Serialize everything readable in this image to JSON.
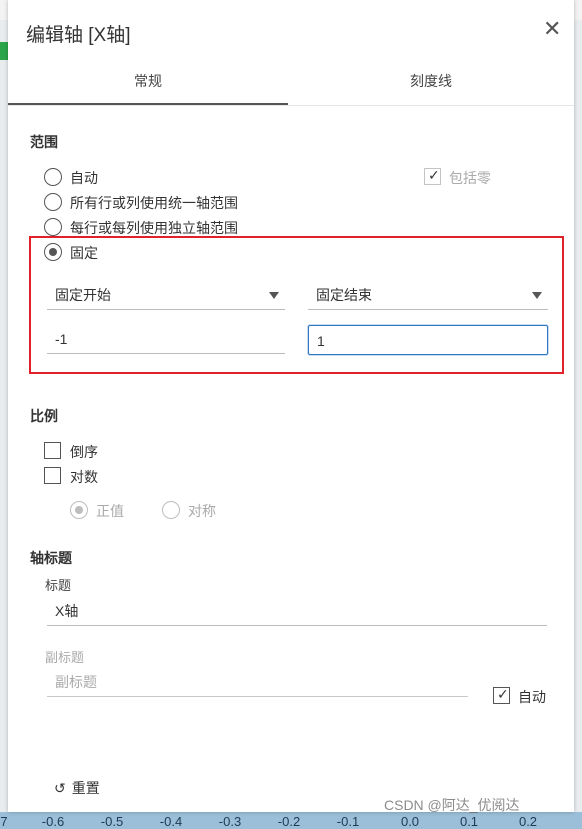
{
  "dialog": {
    "title": "编辑轴 [X轴]",
    "close_icon": "close-icon"
  },
  "tabs": [
    {
      "label": "常规",
      "active": true
    },
    {
      "label": "刻度线",
      "active": false
    }
  ],
  "range": {
    "section_title": "范围",
    "options": [
      {
        "label": "自动",
        "checked": false
      },
      {
        "label": "所有行或列使用统一轴范围",
        "checked": false
      },
      {
        "label": "每行或每列使用独立轴范围",
        "checked": false
      },
      {
        "label": "固定",
        "checked": true
      }
    ],
    "include_zero": {
      "label": "包括零",
      "checked": true,
      "disabled": true
    },
    "fixed_start": {
      "label": "固定开始",
      "value": "-1"
    },
    "fixed_end": {
      "label": "固定结束",
      "value": "1"
    }
  },
  "scale": {
    "section_title": "比例",
    "reversed": {
      "label": "倒序",
      "checked": false
    },
    "log": {
      "label": "对数",
      "checked": false
    },
    "positive": {
      "label": "正值",
      "checked": true,
      "disabled": true
    },
    "symmetric": {
      "label": "对称",
      "checked": false,
      "disabled": true
    }
  },
  "axis_title": {
    "section_title": "轴标题",
    "title_label": "标题",
    "title_value": "X轴",
    "subtitle_label": "副标题",
    "subtitle_placeholder": "副标题",
    "auto": {
      "label": "自动",
      "checked": true
    }
  },
  "reset_label": "重置",
  "watermark": "CSDN @阿达_优阅达",
  "background_axis_ticks": [
    "7",
    "-0.6",
    "-0.5",
    "-0.4",
    "-0.3",
    "-0.2",
    "-0.1",
    "0.0",
    "0.1",
    "0.2"
  ],
  "colors": {
    "highlight": "#e0202a",
    "focus": "#2b78c5",
    "axis_band": "#9bbfd9"
  }
}
